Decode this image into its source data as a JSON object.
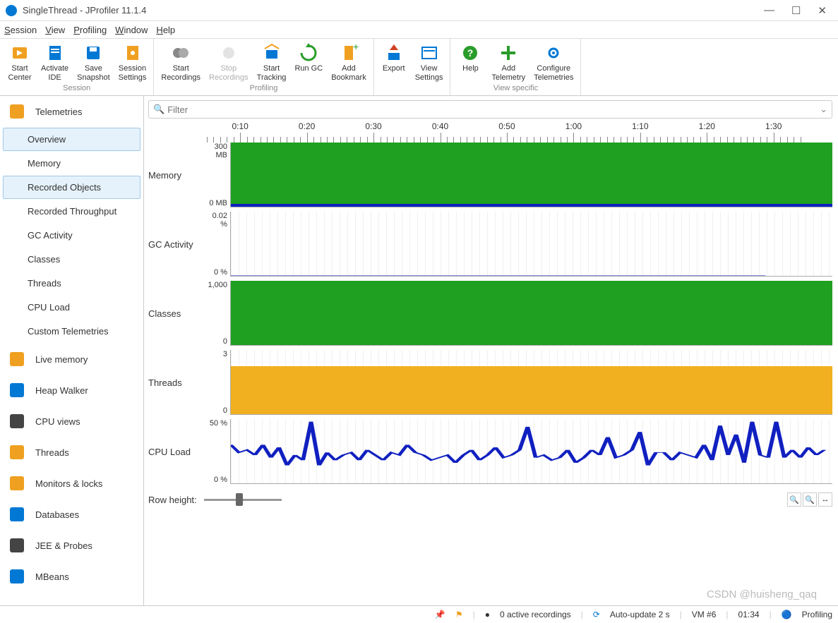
{
  "window": {
    "title": "SingleThread - JProfiler 11.1.4"
  },
  "menu": [
    "Session",
    "View",
    "Profiling",
    "Window",
    "Help"
  ],
  "toolbar": {
    "groups": [
      {
        "label": "Session",
        "items": [
          {
            "name": "start-center",
            "lbl": "Start\nCenter",
            "color": "#f0a020"
          },
          {
            "name": "activate-ide",
            "lbl": "Activate\nIDE",
            "color": "#0078d4"
          },
          {
            "name": "save-snapshot",
            "lbl": "Save\nSnapshot",
            "color": "#0078d4"
          },
          {
            "name": "session-settings",
            "lbl": "Session\nSettings",
            "color": "#f0a020"
          }
        ]
      },
      {
        "label": "Profiling",
        "items": [
          {
            "name": "start-recordings",
            "lbl": "Start\nRecordings",
            "color": "#888"
          },
          {
            "name": "stop-recordings",
            "lbl": "Stop\nRecordings",
            "color": "#bbb",
            "disabled": true
          },
          {
            "name": "start-tracking",
            "lbl": "Start\nTracking",
            "color": "#0078d4"
          },
          {
            "name": "run-gc",
            "lbl": "Run GC",
            "color": "#2a9c2a"
          },
          {
            "name": "add-bookmark",
            "lbl": "Add\nBookmark",
            "color": "#f0a020"
          }
        ]
      },
      {
        "label": "",
        "items": [
          {
            "name": "export",
            "lbl": "Export",
            "color": "#0078d4"
          },
          {
            "name": "view-settings",
            "lbl": "View\nSettings",
            "color": "#0078d4"
          }
        ]
      },
      {
        "label": "View specific",
        "items": [
          {
            "name": "help",
            "lbl": "Help",
            "color": "#2a9c2a"
          },
          {
            "name": "add-telemetry",
            "lbl": "Add\nTelemetry",
            "color": "#2a9c2a"
          },
          {
            "name": "configure-telemetries",
            "lbl": "Configure\nTelemetries",
            "color": "#0078d4"
          }
        ]
      }
    ]
  },
  "sidebar": {
    "categories": [
      {
        "name": "telemetries",
        "label": "Telemetries",
        "iconColor": "#f0a020",
        "items": [
          {
            "label": "Overview",
            "selected": true
          },
          {
            "label": "Memory"
          },
          {
            "label": "Recorded Objects",
            "highlight": true
          },
          {
            "label": "Recorded Throughput"
          },
          {
            "label": "GC Activity"
          },
          {
            "label": "Classes"
          },
          {
            "label": "Threads"
          },
          {
            "label": "CPU Load"
          },
          {
            "label": "Custom Telemetries"
          }
        ]
      },
      {
        "name": "live-memory",
        "label": "Live memory",
        "iconColor": "#f0a020"
      },
      {
        "name": "heap-walker",
        "label": "Heap Walker",
        "iconColor": "#0078d4"
      },
      {
        "name": "cpu-views",
        "label": "CPU views",
        "iconColor": "#444"
      },
      {
        "name": "threads",
        "label": "Threads",
        "iconColor": "#f0a020"
      },
      {
        "name": "monitors-locks",
        "label": "Monitors & locks",
        "iconColor": "#f0a020"
      },
      {
        "name": "databases",
        "label": "Databases",
        "iconColor": "#0078d4"
      },
      {
        "name": "jee-probes",
        "label": "JEE & Probes",
        "iconColor": "#444"
      },
      {
        "name": "mbeans",
        "label": "MBeans",
        "iconColor": "#0078d4"
      }
    ]
  },
  "filter": {
    "placeholder": "Filter"
  },
  "timeline": {
    "ticks": [
      "0:10",
      "0:20",
      "0:30",
      "0:40",
      "0:50",
      "1:00",
      "1:10",
      "1:20",
      "1:30"
    ]
  },
  "rowheight_label": "Row height:",
  "statusbar": {
    "recordings": "0 active recordings",
    "autoupdate": "Auto-update 2 s",
    "vm": "VM #6",
    "time": "01:34",
    "state": "Profiling"
  },
  "watermark": "CSDN @huisheng_qaq",
  "chart_data": [
    {
      "type": "area",
      "title": "Memory",
      "ymin": "0 MB",
      "ymax": "300 MB",
      "series": [
        {
          "name": "heap",
          "color": "#20a020",
          "fill": true,
          "range": [
            0,
            1
          ]
        },
        {
          "name": "used",
          "color": "#1020c0",
          "fill": true,
          "range": [
            0,
            0.04
          ]
        }
      ]
    },
    {
      "type": "area",
      "title": "GC Activity",
      "ymin": "0 %",
      "ymax": "0.02 %",
      "series": [
        {
          "name": "gc",
          "color": "#1020c0",
          "fill": false,
          "values": [
            0,
            0,
            0,
            0,
            0,
            0,
            0,
            0,
            0
          ]
        }
      ]
    },
    {
      "type": "area",
      "title": "Classes",
      "ymin": "0",
      "ymax": "1,000",
      "series": [
        {
          "name": "classes",
          "color": "#20a020",
          "fill": true,
          "range": [
            0,
            1
          ]
        }
      ]
    },
    {
      "type": "area",
      "title": "Threads",
      "ymin": "0",
      "ymax": "3",
      "series": [
        {
          "name": "threads",
          "color": "#f0b020",
          "fill": true,
          "range": [
            0,
            0.75
          ]
        }
      ]
    },
    {
      "type": "line",
      "title": "CPU Load",
      "ymin": "0 %",
      "ymax": "50 %",
      "series": [
        {
          "name": "cpu",
          "color": "#1020c0",
          "values": [
            30,
            24,
            26,
            22,
            30,
            20,
            28,
            14,
            22,
            18,
            48,
            14,
            24,
            18,
            22,
            24,
            18,
            26,
            22,
            18,
            24,
            22,
            30,
            24,
            22,
            18,
            20,
            22,
            16,
            22,
            26,
            18,
            22,
            28,
            20,
            22,
            26,
            44,
            20,
            22,
            18,
            20,
            26,
            16,
            20,
            26,
            22,
            36,
            20,
            22,
            26,
            40,
            14,
            24,
            24,
            18,
            24,
            22,
            20,
            30,
            18,
            45,
            22,
            38,
            16,
            48,
            22,
            20,
            48,
            20,
            26,
            20,
            28,
            22,
            26
          ]
        }
      ]
    }
  ]
}
